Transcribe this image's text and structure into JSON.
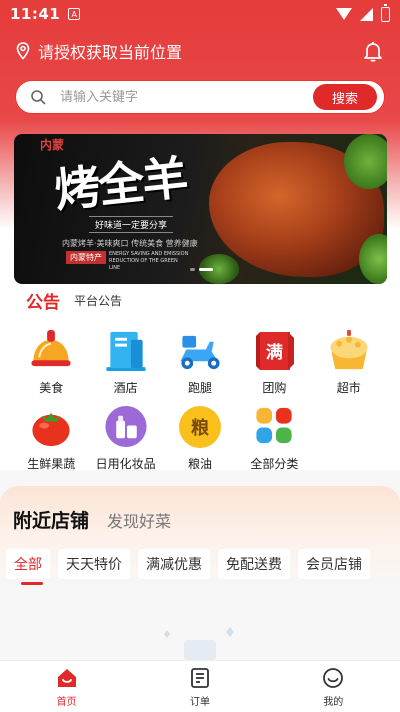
{
  "status_bar": {
    "time": "11:41",
    "notification_icon": "A"
  },
  "location": {
    "text": "请授权获取当前位置"
  },
  "search": {
    "placeholder": "请输入关键字",
    "button_label": "搜索"
  },
  "banner": {
    "tag": "内蒙",
    "title": "烤全羊",
    "slogan": "好味道一定要分享",
    "description": "内蒙烤羊·美味爽口 传统美食 营养健康",
    "seal": "内蒙特产",
    "english": "ENERGY SAVING AND EMISSION REDUCTION OF THE GREEN LINE"
  },
  "notice": {
    "title": "公告",
    "text": "平台公告"
  },
  "categories": [
    {
      "label": "美食",
      "icon": "food-icon"
    },
    {
      "label": "酒店",
      "icon": "hotel-icon"
    },
    {
      "label": "跑腿",
      "icon": "delivery-scooter-icon"
    },
    {
      "label": "团购",
      "icon": "group-buy-icon",
      "glyph": "满"
    },
    {
      "label": "超市",
      "icon": "supermarket-icon"
    },
    {
      "label": "生鲜果蔬",
      "icon": "tomato-icon"
    },
    {
      "label": "日用化妆品",
      "icon": "cosmetics-icon"
    },
    {
      "label": "粮油",
      "icon": "grain-oil-icon",
      "glyph": "粮"
    },
    {
      "label": "全部分类",
      "icon": "all-categories-icon"
    }
  ],
  "nearby": {
    "tab_active": "附近店铺",
    "tab_other": "发现好菜",
    "filters": [
      "全部",
      "天天特价",
      "满减优惠",
      "免配送费",
      "会员店铺"
    ]
  },
  "tabbar": {
    "items": [
      {
        "label": "首页",
        "icon": "home-icon"
      },
      {
        "label": "订单",
        "icon": "order-icon"
      },
      {
        "label": "我的",
        "icon": "profile-icon"
      }
    ]
  },
  "colors": {
    "brand_red": "#e02a2a",
    "header_red": "#e53b3b"
  }
}
